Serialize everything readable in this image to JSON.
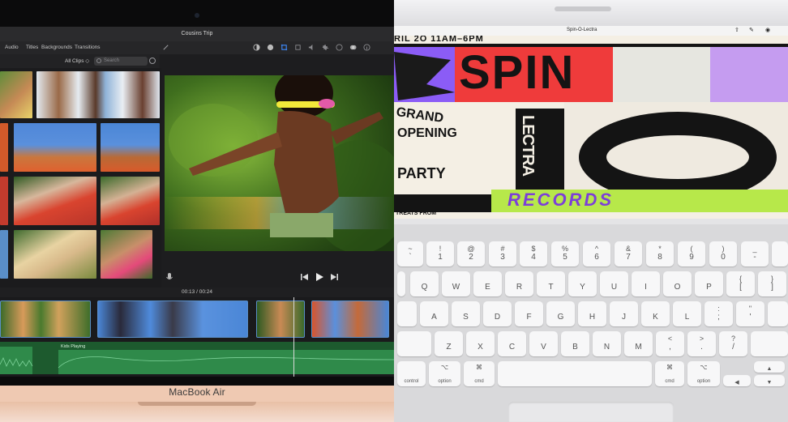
{
  "macbook": {
    "label": "MacBook Air",
    "imovie": {
      "project_title": "Cousins Trip",
      "menu": [
        "Audio",
        "Titles",
        "Backgrounds",
        "Transitions"
      ],
      "all_clips": "All Clips ◇",
      "search_placeholder": "Search",
      "timecode": "00:13",
      "timecode_separator": " / ",
      "duration": "00:24",
      "audio_track_label": "Kids Playing",
      "accent_color": "#5a8ec7",
      "audio_color": "#1d5a2e"
    }
  },
  "ipad": {
    "status_title": "Spin-O-Lectra",
    "poster": {
      "date_line": "RIL 2O 11AM–6PM",
      "word_spin": "SPIN",
      "word_o": "O",
      "lectra": "LECTRA",
      "grand": "GRAND",
      "opening": "OPENING",
      "party": "PARTY",
      "records": "RECORDS",
      "treats": "TREATS FROM"
    },
    "keyboard": {
      "row1": [
        {
          "top": "~",
          "main": "`"
        },
        {
          "top": "!",
          "main": "1"
        },
        {
          "top": "@",
          "main": "2"
        },
        {
          "top": "#",
          "main": "3"
        },
        {
          "top": "$",
          "main": "4"
        },
        {
          "top": "%",
          "main": "5"
        },
        {
          "top": "^",
          "main": "6"
        },
        {
          "top": "&",
          "main": "7"
        },
        {
          "top": "*",
          "main": "8"
        },
        {
          "top": "(",
          "main": "9"
        },
        {
          "top": ")",
          "main": "0"
        },
        {
          "top": "_",
          "main": "-"
        }
      ],
      "row2": [
        "Q",
        "W",
        "E",
        "R",
        "T",
        "Y",
        "U",
        "I",
        "O",
        "P"
      ],
      "row2_brackets": [
        {
          "top": "{",
          "main": "["
        },
        {
          "top": "}",
          "main": "]"
        }
      ],
      "row3": [
        "A",
        "S",
        "D",
        "F",
        "G",
        "H",
        "J",
        "K",
        "L"
      ],
      "row3_punct": [
        {
          "top": ":",
          "main": ";"
        },
        {
          "top": "\"",
          "main": "'"
        }
      ],
      "row4": [
        "Z",
        "X",
        "C",
        "V",
        "B",
        "N",
        "M"
      ],
      "row4_punct": [
        {
          "top": "<",
          "main": ","
        },
        {
          "top": ">",
          "main": "."
        },
        {
          "top": "?",
          "main": "/"
        }
      ],
      "control": "control",
      "option_left": "option",
      "option_right": "option",
      "cmd_left": "cmd",
      "cmd_right": "cmd",
      "option_glyph": "⌥",
      "cmd_glyph": "⌘"
    }
  }
}
